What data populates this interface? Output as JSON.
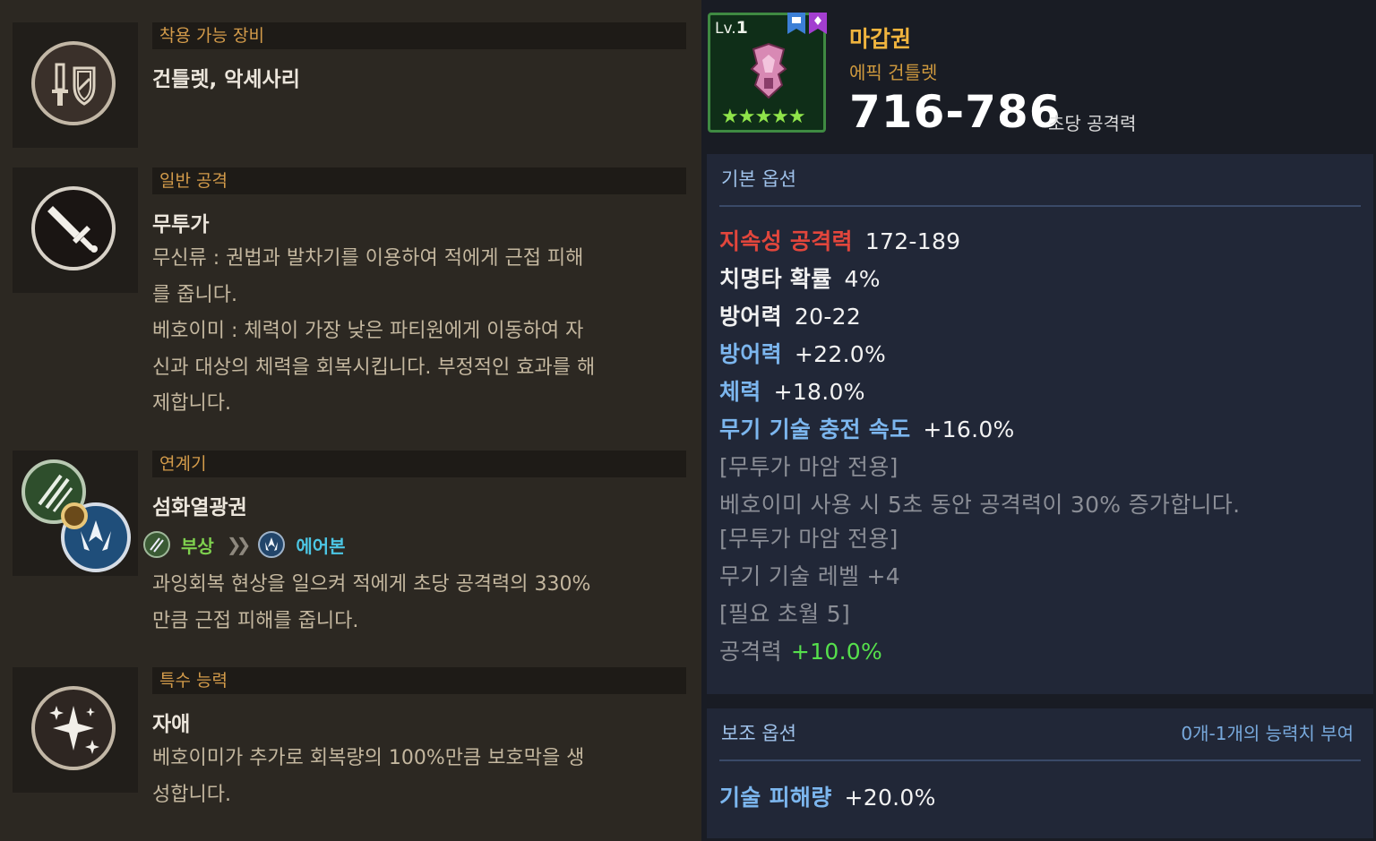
{
  "sections": [
    {
      "icon": "sword-shield-icon",
      "header": "착용 가능 장비",
      "title": "건틀렛, 악세사리",
      "lines": []
    },
    {
      "icon": "sword-icon",
      "header": "일반 공격",
      "title": "무투가",
      "lines": [
        "무신류 : 권법과 발차기를 이용하여 적에게 근접 피해",
        "를 줍니다.",
        "베호이미 : 체력이 가장 낮은 파티원에게 이동하여 자",
        "신과 대상의 체력을 회복시킵니다. 부정적인 효과를 해",
        "제합니다."
      ]
    },
    {
      "icon": "chain-skill-icon",
      "header": "연계기",
      "title": "섬화열광권",
      "combo": {
        "from": "부상",
        "to": "에어본"
      },
      "lines": [
        "과잉회복 현상을 일으켜 적에게 초당 공격력의 330%",
        "만큼 근접 피해를 줍니다."
      ]
    },
    {
      "icon": "sparkle-icon",
      "header": "특수 능력",
      "title": "자애",
      "lines": [
        "베호이미가 추가로 회복량의 100%만큼 보호막을 생",
        "성합니다."
      ]
    }
  ],
  "item": {
    "level_prefix": "Lv.",
    "level": "1",
    "stars": "★★★★★",
    "name": "마갑권",
    "type": "에픽 건틀렛",
    "damage": "716-786",
    "damage_unit": "초당 공격력"
  },
  "basic": {
    "header": "기본 옵션",
    "options": [
      {
        "k": "지속성 공격력",
        "v": "172-189",
        "kcolor": "red"
      },
      {
        "k": "치명타 확률",
        "v": "4%",
        "kcolor": "white"
      },
      {
        "k": "방어력",
        "v": "20-22",
        "kcolor": "white"
      },
      {
        "k": "방어력",
        "v": "+22.0%",
        "kcolor": "blue"
      },
      {
        "k": "체력",
        "v": "+18.0%",
        "kcolor": "blue"
      },
      {
        "k": "무기 기술 충전 속도",
        "v": "+16.0%",
        "kcolor": "blue"
      }
    ],
    "notes": [
      {
        "text": "[무투가 마암 전용]"
      },
      {
        "text": "베호이미 사용 시 5초 동안 공격력이 30% 증가합니다."
      },
      {
        "text": "[무투가 마암 전용]"
      },
      {
        "text": "무기 기술 레벨 +4"
      },
      {
        "text": "[필요 초월 5]"
      },
      {
        "text": "공격력",
        "extra": "+10.0%"
      }
    ]
  },
  "sub": {
    "header": "보조 옵션",
    "right": "0개-1개의 능력치 부여",
    "options": [
      {
        "k": "기술 피해량",
        "v": "+20.0%"
      }
    ]
  },
  "colors": {
    "gold": "#f0b43e",
    "epic_orange": "#d09a3e",
    "stat_red": "#e2463c",
    "stat_blue": "#7cb6ee",
    "bonus_green": "#56e04c",
    "section_header": "#d39b4a"
  }
}
